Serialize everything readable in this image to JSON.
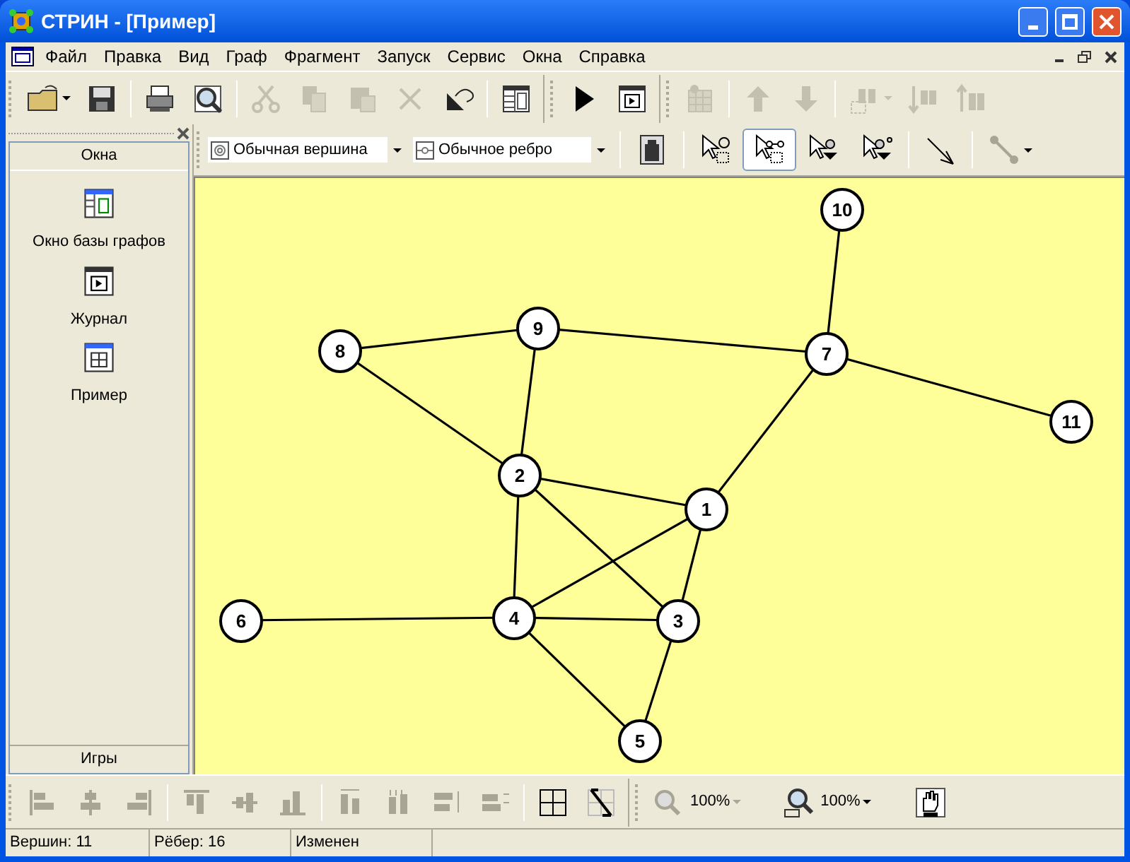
{
  "window": {
    "title": "СТРИН - [Пример]"
  },
  "menu": [
    "Файл",
    "Правка",
    "Вид",
    "Граф",
    "Фрагмент",
    "Запуск",
    "Сервис",
    "Окна",
    "Справка"
  ],
  "toolbar_main": [
    [
      {
        "kind": "open",
        "disabled": false
      },
      {
        "kind": "save",
        "disabled": false
      },
      {
        "kind": "print",
        "disabled": false
      },
      {
        "kind": "preview",
        "disabled": false
      },
      {
        "kind": "cut",
        "disabled": true
      },
      {
        "kind": "copy",
        "disabled": true
      },
      {
        "kind": "paste",
        "disabled": true
      },
      {
        "kind": "delete",
        "disabled": true
      },
      {
        "kind": "undo",
        "disabled": false
      },
      {
        "kind": "table",
        "disabled": false
      }
    ],
    [
      {
        "kind": "run",
        "disabled": false
      },
      {
        "kind": "log",
        "disabled": false
      }
    ],
    [
      {
        "kind": "grid",
        "disabled": true
      },
      {
        "kind": "up",
        "disabled": true
      },
      {
        "kind": "down",
        "disabled": true
      },
      {
        "kind": "find",
        "disabled": true
      },
      {
        "kind": "finddown",
        "disabled": true
      },
      {
        "kind": "findup",
        "disabled": true
      }
    ]
  ],
  "toolbar_edit": {
    "vertex_type": "Обычная вершина",
    "edge_type": "Обычное ребро",
    "tools": [
      {
        "kind": "weight",
        "selected": false
      },
      {
        "kind": "selvertex",
        "selected": false
      },
      {
        "kind": "seledge",
        "selected": true
      },
      {
        "kind": "selin",
        "selected": false
      },
      {
        "kind": "selout",
        "selected": false
      },
      {
        "kind": "arrow",
        "selected": false
      },
      {
        "kind": "path",
        "selected": false
      }
    ]
  },
  "sidebar": {
    "header": "Окна",
    "items": [
      {
        "kind": "db",
        "label": "Окно базы графов"
      },
      {
        "kind": "log",
        "label": "Журнал"
      },
      {
        "kind": "graph",
        "label": "Пример"
      }
    ],
    "footer": "Игры"
  },
  "graph": {
    "nodes": [
      "10",
      "8",
      "9",
      "7",
      "11",
      "2",
      "1",
      "6",
      "4",
      "3",
      "5"
    ]
  },
  "toolbar_align": {
    "zoom": "100%",
    "zoom_all": "100%"
  },
  "status_bar": [
    "Вершин: 11",
    "Рёбер: 16",
    "Изменен"
  ]
}
